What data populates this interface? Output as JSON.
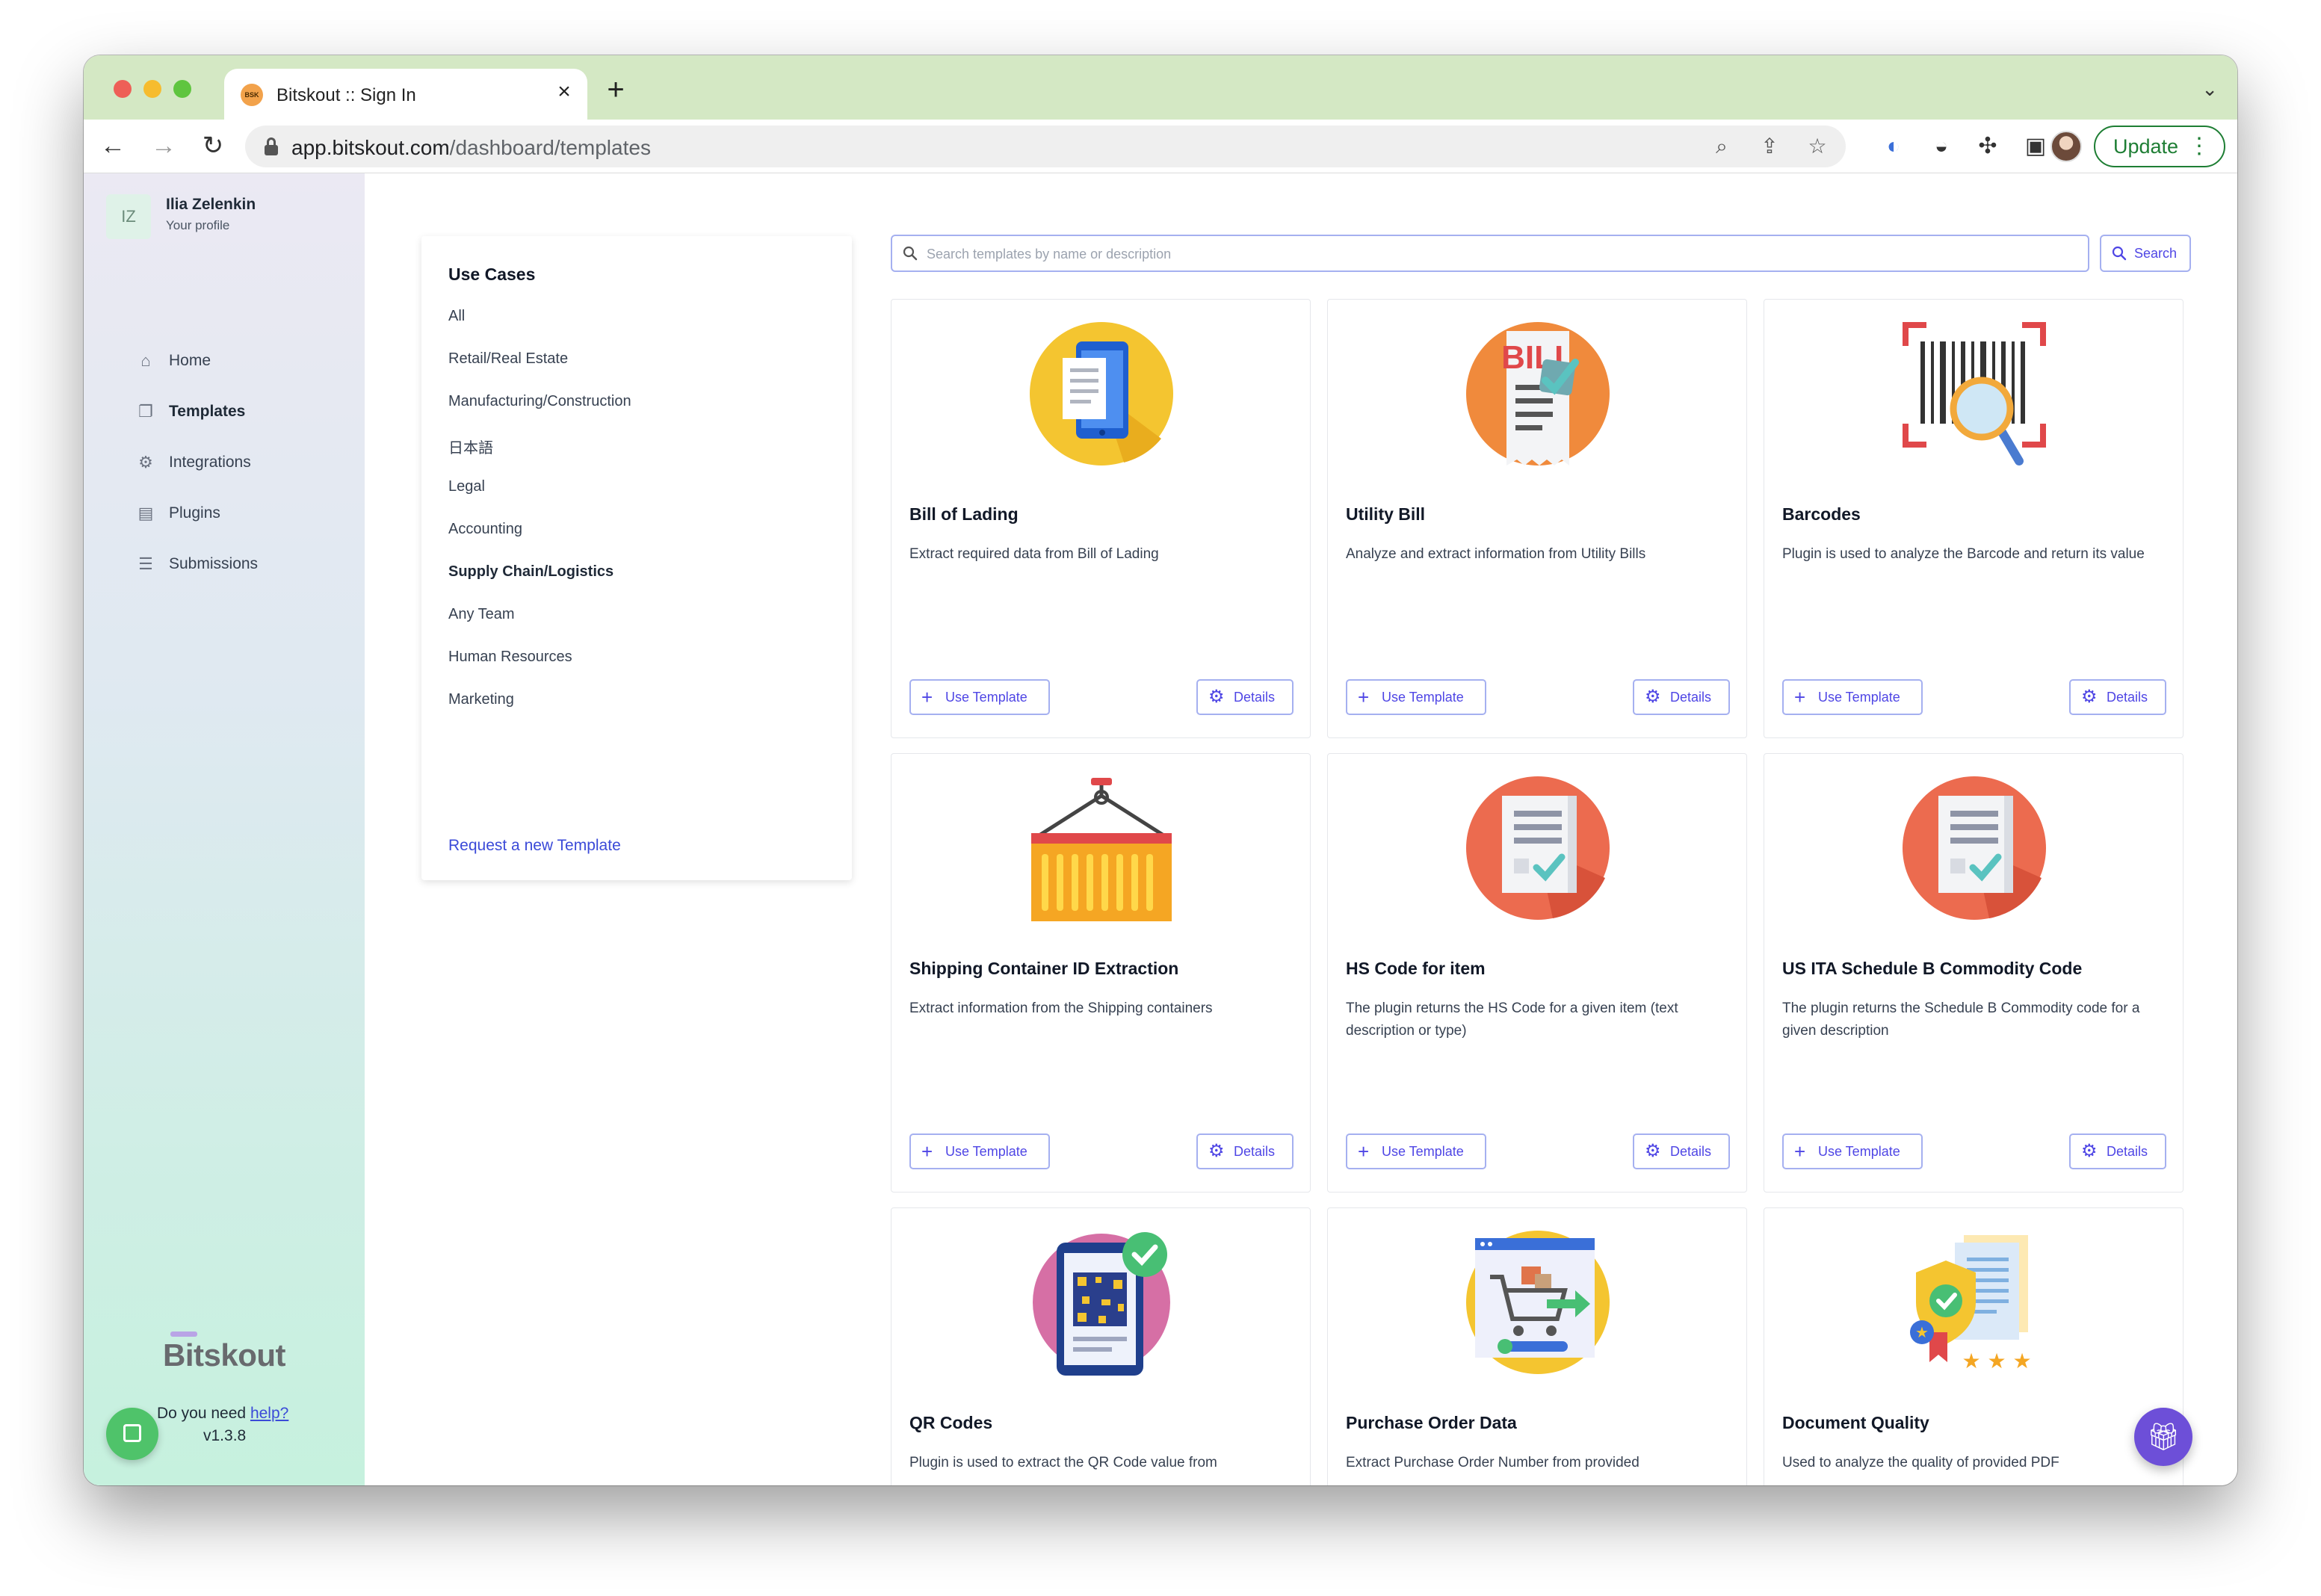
{
  "browser": {
    "tab_title": "Bitskout :: Sign In",
    "tab_favicon_text": "BSK",
    "url_domain": "app.bitskout.com",
    "url_path": "/dashboard/templates",
    "update_label": "Update"
  },
  "profile": {
    "initials": "IZ",
    "name": "Ilia Zelenkin",
    "subtitle": "Your profile"
  },
  "sidebar": {
    "items": [
      {
        "label": "Home",
        "icon": "home-icon"
      },
      {
        "label": "Templates",
        "icon": "templates-icon",
        "active": true
      },
      {
        "label": "Integrations",
        "icon": "gear-icon"
      },
      {
        "label": "Plugins",
        "icon": "plugins-icon"
      },
      {
        "label": "Submissions",
        "icon": "list-icon"
      }
    ],
    "brand": "Bitskout",
    "help_prefix": "Do you need ",
    "help_link": "help?",
    "version": "v1.3.8"
  },
  "use_cases": {
    "title": "Use Cases",
    "items": [
      "All",
      "Retail/Real Estate",
      "Manufacturing/Construction",
      "日本語",
      "Legal",
      "Accounting",
      "Supply Chain/Logistics",
      "Any Team",
      "Human Resources",
      "Marketing"
    ],
    "active_item": "Supply Chain/Logistics",
    "request_link": "Request a new Template"
  },
  "search": {
    "placeholder": "Search templates by name or description",
    "value": "",
    "button_label": "Search"
  },
  "buttons": {
    "use_template": "Use Template",
    "details": "Details"
  },
  "templates": [
    {
      "title": "Bill of Lading",
      "description": "Extract required data from Bill of Lading",
      "icon": "mobile-document-icon"
    },
    {
      "title": "Utility Bill",
      "description": "Analyze and extract information from Utility Bills",
      "icon": "bill-icon"
    },
    {
      "title": "Barcodes",
      "description": "Plugin is used to analyze the Barcode and return its value",
      "icon": "barcode-scan-icon"
    },
    {
      "title": "Shipping Container ID Extraction",
      "description": "Extract information from the Shipping containers",
      "icon": "shipping-container-icon"
    },
    {
      "title": "HS Code for item",
      "description": "The plugin returns the HS Code for a given item (text description or type)",
      "icon": "document-check-icon"
    },
    {
      "title": "US ITA Schedule B Commodity Code",
      "description": "The plugin returns the Schedule B Commodity code for a given description",
      "icon": "document-check-icon"
    },
    {
      "title": "QR Codes",
      "description": "Plugin is used to extract the QR Code value from",
      "icon": "qr-code-icon"
    },
    {
      "title": "Purchase Order Data",
      "description": "Extract Purchase Order Number from provided",
      "icon": "shopping-cart-icon"
    },
    {
      "title": "Document Quality",
      "description": "Used to analyze the quality of provided PDF",
      "icon": "quality-badge-icon"
    }
  ],
  "colors": {
    "accent": "#4f46e5",
    "link": "#3b4ad8",
    "titlebar": "#d4e8c4",
    "help_button": "#4fc36a",
    "gift_button": "#6d4fd8"
  }
}
